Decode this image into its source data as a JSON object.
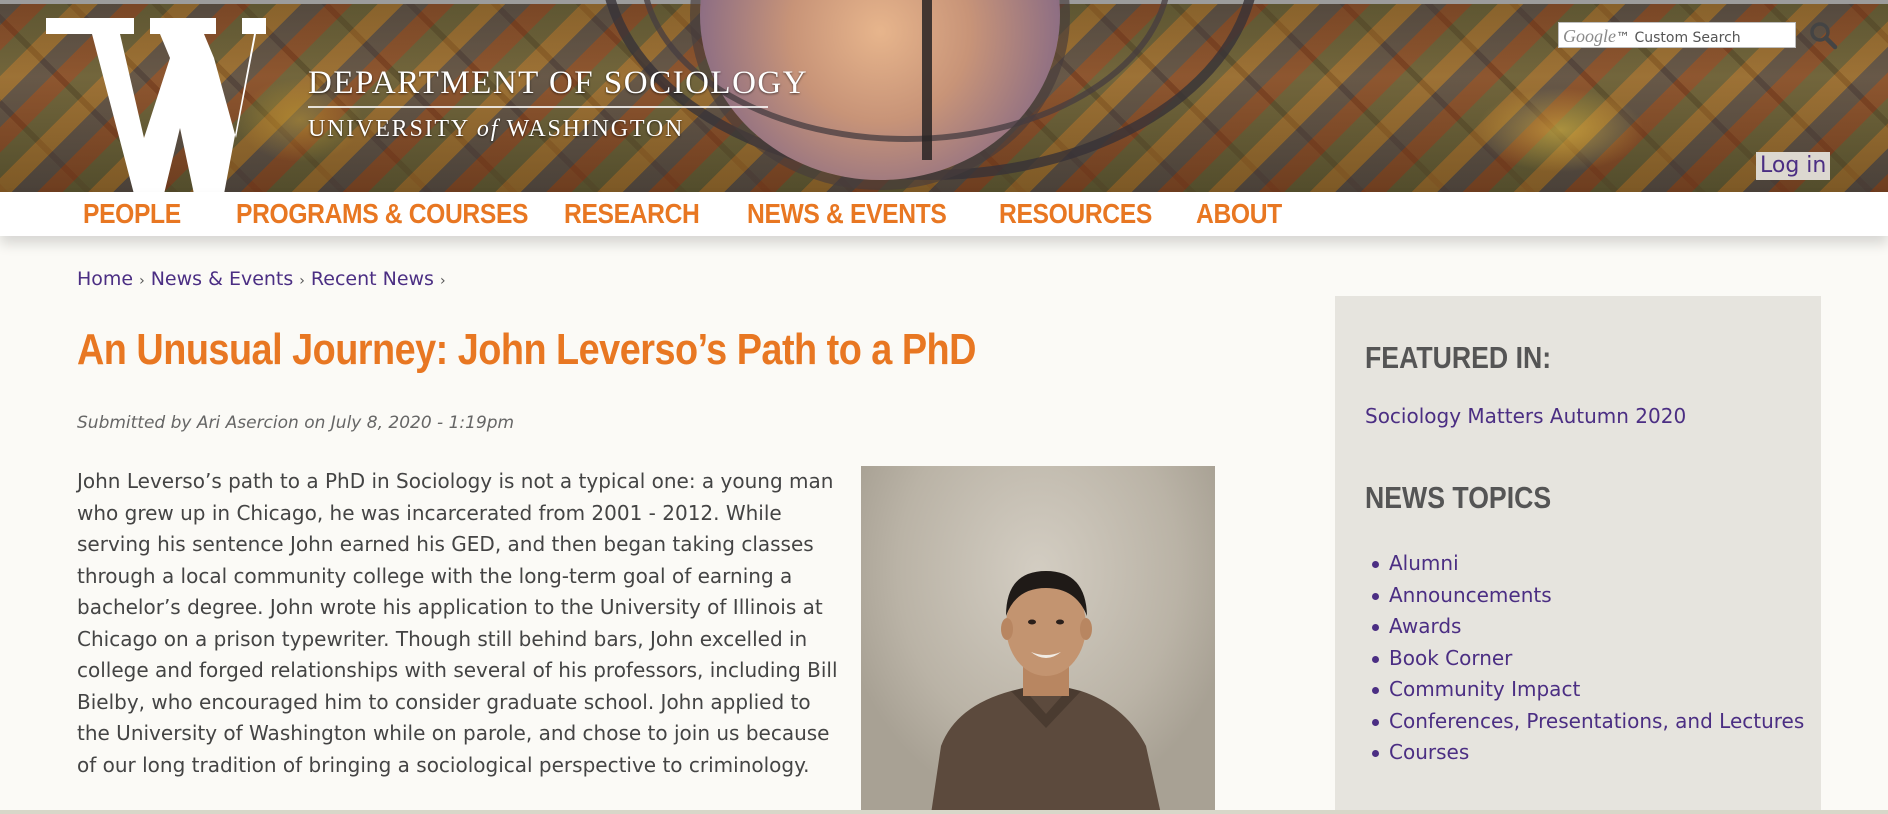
{
  "header": {
    "dept_name": "DEPARTMENT OF SOCIOLOGY",
    "univ_part1": "UNIVERSITY",
    "univ_of": "of",
    "univ_part2": "WASHINGTON",
    "search_brand": "Google",
    "search_placeholder": "Custom Search",
    "login_label": "Log in"
  },
  "nav": {
    "items": [
      "PEOPLE",
      "PROGRAMS & COURSES",
      "RESEARCH",
      "NEWS & EVENTS",
      "RESOURCES",
      "ABOUT"
    ]
  },
  "breadcrumb": {
    "items": [
      "Home",
      "News & Events",
      "Recent News"
    ],
    "separator": "›"
  },
  "article": {
    "title": "An Unusual Journey: John Leverso’s Path to a PhD",
    "submitted": "Submitted by Ari Asercion on July 8, 2020 - 1:19pm",
    "body": "John Leverso’s path to a PhD in Sociology is not a typical one: a young man who grew up in Chicago, he was incarcerated from 2001 - 2012. While serving his sentence John earned his GED, and then began taking classes through a local community college with the long-term goal of earning a bachelor’s degree. John wrote his application to the University of Illinois at Chicago on a prison typewriter. Though still behind bars, John excelled in college and forged relationships with several of his professors, including Bill Bielby, who encouraged him to consider graduate school. John applied to the University of Washington while on parole, and chose to join us because of our long tradition of bringing a sociological perspective to criminology."
  },
  "sidebar": {
    "featured_heading": "FEATURED IN:",
    "featured_link": "Sociology Matters Autumn 2020",
    "topics_heading": "NEWS TOPICS",
    "topics": [
      "Alumni",
      "Announcements",
      "Awards",
      "Book Corner",
      "Community Impact",
      "Conferences, Presentations, and Lectures",
      "Courses"
    ]
  },
  "colors": {
    "accent_gold": "#e87722",
    "uw_purple": "#4b2e83",
    "sidebar_bg": "#e6e4de"
  }
}
